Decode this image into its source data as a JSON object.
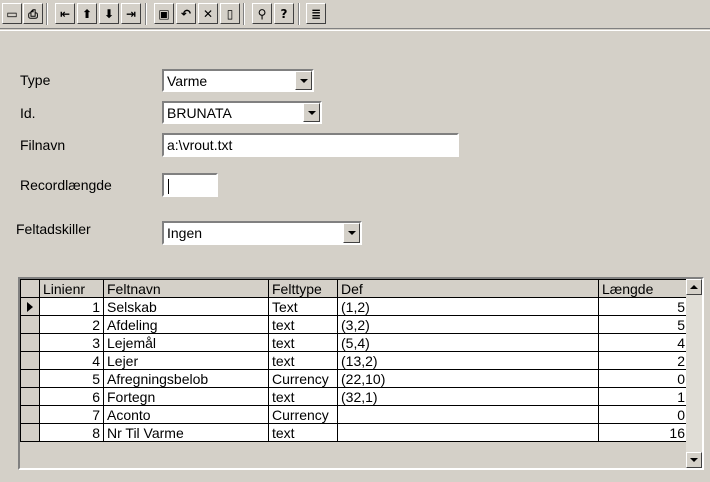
{
  "toolbar": {
    "buttons": [
      {
        "name": "first-button",
        "icon": "record-marker-icon",
        "glyph": "▭"
      },
      {
        "name": "print-button",
        "icon": "printer-icon",
        "glyph": "⎙"
      },
      {
        "name": "first-record-button",
        "icon": "first-record-icon",
        "glyph": "⇤"
      },
      {
        "name": "previous-record-button",
        "icon": "arrow-up-icon",
        "glyph": "⬆"
      },
      {
        "name": "next-record-button",
        "icon": "arrow-down-icon",
        "glyph": "⬇"
      },
      {
        "name": "last-record-button",
        "icon": "last-record-icon",
        "glyph": "⇥"
      },
      {
        "name": "save-button",
        "icon": "floppy-disk-icon",
        "glyph": "▣"
      },
      {
        "name": "undo-button",
        "icon": "undo-icon",
        "glyph": "↶"
      },
      {
        "name": "delete-button",
        "icon": "close-icon",
        "glyph": "✕"
      },
      {
        "name": "new-button",
        "icon": "new-document-icon",
        "glyph": "▯"
      },
      {
        "name": "find-button",
        "icon": "binoculars-icon",
        "glyph": "⚲"
      },
      {
        "name": "help-button",
        "icon": "help-pointer-icon",
        "glyph": "?"
      },
      {
        "name": "notes-button",
        "icon": "notepad-icon",
        "glyph": "≣"
      }
    ]
  },
  "form": {
    "type_label": "Type",
    "type_value": "Varme",
    "id_label": "Id.",
    "id_value": "BRUNATA",
    "filnavn_label": "Filnavn",
    "filnavn_value": "a:\\vrout.txt",
    "recordlaengde_label": "Recordlængde",
    "recordlaengde_value": "",
    "feltadskiller_label": "Feltadskiller",
    "feltadskiller_value": "Ingen"
  },
  "grid": {
    "columns": [
      "Linienr",
      "Feltnavn",
      "Felttype",
      "Def",
      "Længde"
    ],
    "rows": [
      {
        "linienr": "1",
        "feltnavn": "Selskab",
        "felttype": "Text",
        "def": "(1,2)",
        "laengde": "5"
      },
      {
        "linienr": "2",
        "feltnavn": "Afdeling",
        "felttype": "text",
        "def": "(3,2)",
        "laengde": "5"
      },
      {
        "linienr": "3",
        "feltnavn": "Lejemål",
        "felttype": "text",
        "def": "(5,4)",
        "laengde": "4"
      },
      {
        "linienr": "4",
        "feltnavn": "Lejer",
        "felttype": "text",
        "def": "(13,2)",
        "laengde": "2"
      },
      {
        "linienr": "5",
        "feltnavn": "Afregningsbelob",
        "felttype": "Currency",
        "def": "(22,10)",
        "laengde": "0"
      },
      {
        "linienr": "6",
        "feltnavn": "Fortegn",
        "felttype": "text",
        "def": "(32,1)",
        "laengde": "1"
      },
      {
        "linienr": "7",
        "feltnavn": "Aconto",
        "felttype": "Currency",
        "def": "",
        "laengde": "0"
      },
      {
        "linienr": "8",
        "feltnavn": "Nr Til Varme",
        "felttype": "text",
        "def": "",
        "laengde": "16"
      }
    ]
  }
}
